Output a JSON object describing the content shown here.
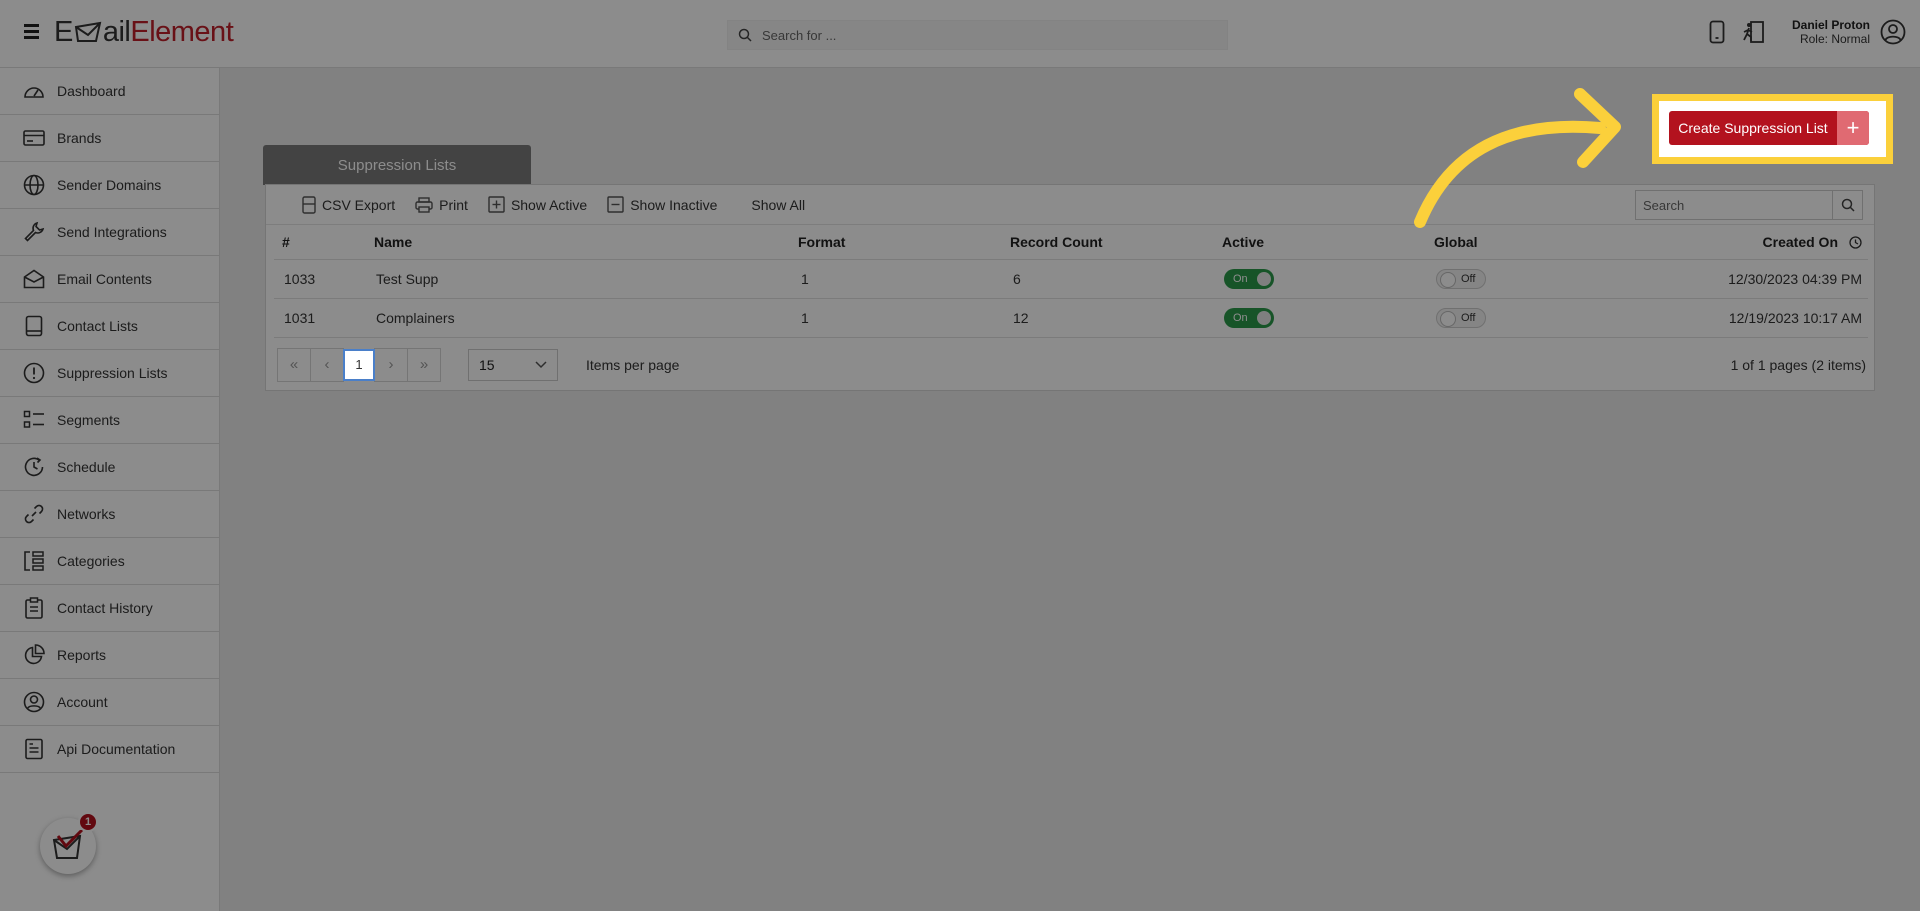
{
  "header": {
    "logo_e": "E",
    "logo_mail": "ail",
    "logo_element": "Element",
    "search_placeholder": "Search for ...",
    "user_name": "Daniel Proton",
    "user_role": "Role: Normal"
  },
  "sidebar": {
    "items": [
      {
        "label": "Dashboard",
        "icon": "dashboard-icon"
      },
      {
        "label": "Brands",
        "icon": "brands-icon"
      },
      {
        "label": "Sender Domains",
        "icon": "globe-icon"
      },
      {
        "label": "Send Integrations",
        "icon": "wrench-icon"
      },
      {
        "label": "Email Contents",
        "icon": "envelope-icon"
      },
      {
        "label": "Contact Lists",
        "icon": "book-icon"
      },
      {
        "label": "Suppression Lists",
        "icon": "alert-icon"
      },
      {
        "label": "Segments",
        "icon": "segments-icon"
      },
      {
        "label": "Schedule",
        "icon": "clock-icon"
      },
      {
        "label": "Networks",
        "icon": "link-icon"
      },
      {
        "label": "Categories",
        "icon": "categories-icon"
      },
      {
        "label": "Contact History",
        "icon": "clipboard-icon"
      },
      {
        "label": "Reports",
        "icon": "pie-icon"
      },
      {
        "label": "Account",
        "icon": "user-circle-icon"
      },
      {
        "label": "Api Documentation",
        "icon": "document-icon"
      }
    ],
    "notification_count": "1"
  },
  "main": {
    "create_button": "Create Suppression List",
    "create_plus": "+",
    "panel_title": "Suppression Lists",
    "toolbar": {
      "csv": "CSV Export",
      "print": "Print",
      "active": "Show Active",
      "inactive": "Show Inactive",
      "all": "Show All"
    },
    "grid_search_placeholder": "Search",
    "columns": [
      "#",
      "Name",
      "Format",
      "Record Count",
      "Active",
      "Global",
      "Created On"
    ],
    "rows": [
      {
        "id": "1033",
        "name": "Test Supp",
        "format": "1",
        "count": "6",
        "active": "On",
        "global": "Off",
        "created": "12/30/2023 04:39 PM"
      },
      {
        "id": "1031",
        "name": "Complainers",
        "format": "1",
        "count": "12",
        "active": "On",
        "global": "Off",
        "created": "12/19/2023 10:17 AM"
      }
    ],
    "pager": {
      "first": "«",
      "prev": "‹",
      "current": "1",
      "next": "›",
      "last": "»",
      "page_size": "15",
      "items_per_page": "Items per page",
      "summary": "1 of 1 pages (2 items)"
    }
  },
  "colors": {
    "brand_red": "#b3121e",
    "highlight_yellow": "#fbd03b",
    "toggle_green": "#2a9a4a"
  }
}
